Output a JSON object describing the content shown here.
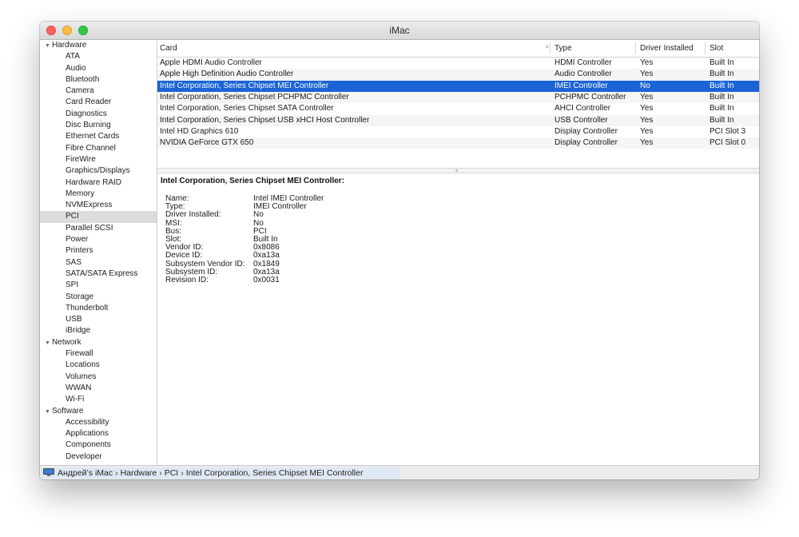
{
  "window": {
    "title": "iMac"
  },
  "sidebar": {
    "groups": [
      {
        "label": "Hardware",
        "items": [
          "ATA",
          "Audio",
          "Bluetooth",
          "Camera",
          "Card Reader",
          "Diagnostics",
          "Disc Burning",
          "Ethernet Cards",
          "Fibre Channel",
          "FireWire",
          "Graphics/Displays",
          "Hardware RAID",
          "Memory",
          "NVMExpress",
          "PCI",
          "Parallel SCSI",
          "Power",
          "Printers",
          "SAS",
          "SATA/SATA Express",
          "SPI",
          "Storage",
          "Thunderbolt",
          "USB",
          "iBridge"
        ]
      },
      {
        "label": "Network",
        "items": [
          "Firewall",
          "Locations",
          "Volumes",
          "WWAN",
          "Wi-Fi"
        ]
      },
      {
        "label": "Software",
        "items": [
          "Accessibility",
          "Applications",
          "Components",
          "Developer"
        ]
      }
    ],
    "selected": "PCI"
  },
  "table": {
    "columns": {
      "card": "Card",
      "type": "Type",
      "driver": "Driver Installed",
      "slot": "Slot"
    },
    "sort_indicator": "^",
    "selected_row": 2,
    "rows": [
      [
        "Apple HDMI Audio Controller",
        "HDMI Controller",
        "Yes",
        "Built In"
      ],
      [
        "Apple High Definition Audio Controller",
        "Audio Controller",
        "Yes",
        "Built In"
      ],
      [
        "Intel Corporation, Series Chipset MEI Controller",
        "IMEI Controller",
        "No",
        "Built In"
      ],
      [
        "Intel Corporation, Series Chipset PCHPMC Controller",
        "PCHPMC Controller",
        "Yes",
        "Built In"
      ],
      [
        "Intel Corporation, Series Chipset SATA Controller",
        "AHCI Controller",
        "Yes",
        "Built In"
      ],
      [
        "Intel Corporation, Series Chipset USB xHCI Host Controller",
        "USB Controller",
        "Yes",
        "Built In"
      ],
      [
        "Intel HD Graphics 610",
        "Display Controller",
        "Yes",
        "PCI Slot 3"
      ],
      [
        "NVIDIA GeForce GTX 650",
        "Display Controller",
        "Yes",
        "PCI Slot 0"
      ]
    ]
  },
  "detail": {
    "title": "Intel Corporation, Series Chipset MEI Controller:",
    "fields": [
      [
        "Name:",
        "Intel IMEI Controller"
      ],
      [
        "Type:",
        "IMEI Controller"
      ],
      [
        "Driver Installed:",
        "No"
      ],
      [
        "MSI:",
        "No"
      ],
      [
        "Bus:",
        "PCI"
      ],
      [
        "Slot:",
        "Built In"
      ],
      [
        "Vendor ID:",
        "0x8086"
      ],
      [
        "Device ID:",
        "0xa13a"
      ],
      [
        "Subsystem Vendor ID:",
        "0x1849"
      ],
      [
        "Subsystem ID:",
        "0xa13a"
      ],
      [
        "Revision ID:",
        "0x0031"
      ]
    ]
  },
  "statusbar": {
    "crumbs": [
      "Андрей’s iMac",
      "Hardware",
      "PCI",
      "Intel Corporation, Series Chipset MEI Controller"
    ],
    "separator": "›"
  },
  "colors": {
    "selection": "#1a64d6",
    "close": "#fc605c",
    "minimize": "#fdbc40",
    "maximize": "#34c84a"
  }
}
